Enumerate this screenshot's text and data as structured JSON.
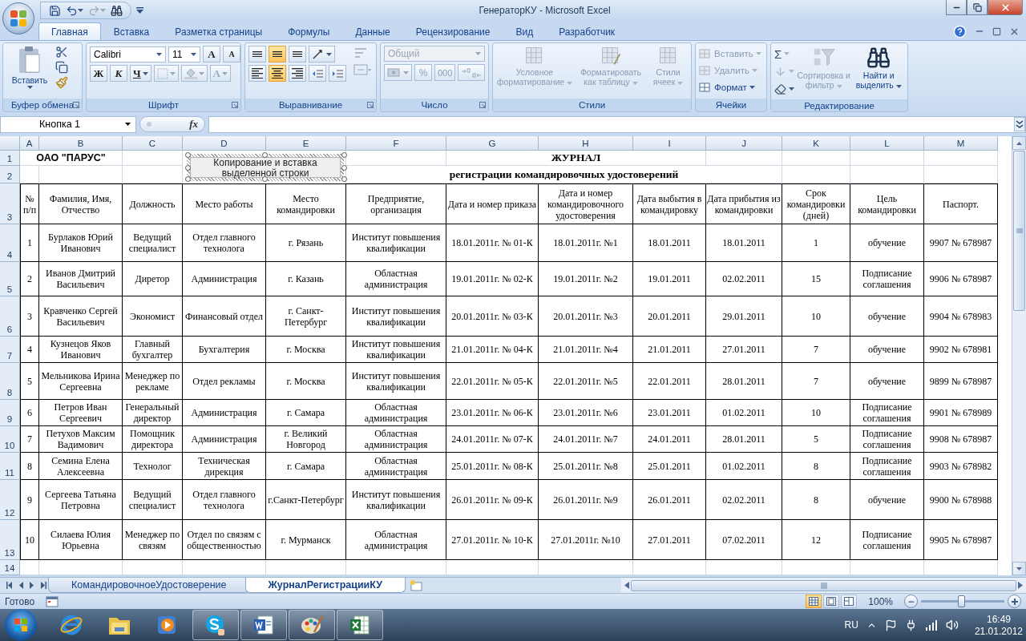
{
  "window": {
    "title": "ГенераторКУ - Microsoft Excel"
  },
  "ribbon_tabs": [
    {
      "label": "Главная",
      "selected": true
    },
    {
      "label": "Вставка",
      "selected": false
    },
    {
      "label": "Разметка страницы",
      "selected": false
    },
    {
      "label": "Формулы",
      "selected": false
    },
    {
      "label": "Данные",
      "selected": false
    },
    {
      "label": "Рецензирование",
      "selected": false
    },
    {
      "label": "Вид",
      "selected": false
    },
    {
      "label": "Разработчик",
      "selected": false
    }
  ],
  "ribbon": {
    "clipboard": {
      "label": "Буфер обмена",
      "paste": "Вставить"
    },
    "font": {
      "label": "Шрифт",
      "name": "Calibri",
      "size": "11",
      "grow": "A",
      "shrink": "A",
      "bold": "Ж",
      "italic": "К",
      "underline": "Ч",
      "color_letter": "A"
    },
    "alignment": {
      "label": "Выравнивание",
      "vertical": [
        {
          "selected": false
        },
        {
          "selected": true
        },
        {
          "selected": false
        }
      ],
      "horizontal": [
        {
          "selected": false
        },
        {
          "selected": true
        },
        {
          "selected": false
        }
      ]
    },
    "number": {
      "label": "Число",
      "format": "Общий",
      "format_disabled": true,
      "percent": "%",
      "thousands": "000"
    },
    "styles": {
      "label": "Стили",
      "items": [
        {
          "label": "Условное форматирование",
          "disabled": true
        },
        {
          "label": "Форматировать как таблицу",
          "disabled": true
        },
        {
          "label": "Стили ячеек",
          "disabled": true
        }
      ]
    },
    "cells": {
      "label": "Ячейки",
      "items": [
        {
          "label": "Вставить",
          "disabled": true
        },
        {
          "label": "Удалить",
          "disabled": true
        },
        {
          "label": "Формат",
          "disabled": false
        }
      ]
    },
    "editing": {
      "label": "Редактирование",
      "sum": "Σ",
      "items": [
        {
          "label": "Сортировка и фильтр",
          "disabled": true
        },
        {
          "label": "Найти и выделить",
          "disabled": false
        }
      ]
    }
  },
  "formula_bar": {
    "name_box": "Кнопка 1",
    "fx": "fx"
  },
  "sheet": {
    "columns": [
      "A",
      "B",
      "C",
      "D",
      "E",
      "F",
      "G",
      "H",
      "I",
      "J",
      "K",
      "L",
      "M"
    ],
    "rows": [
      "1",
      "2",
      "3",
      "4",
      "5",
      "6",
      "7",
      "8",
      "9",
      "10",
      "11",
      "12",
      "13",
      "14"
    ],
    "company": "ОАО \"ПАРУС\"",
    "title": "ЖУРНАЛ",
    "subtitle": "регистрации командировочных удостоверений",
    "button": "Копирование и вставка выделенной строки",
    "header": [
      "№ п/п",
      "Фамилия, Имя, Отчество",
      "Должность",
      "Место работы",
      "Место командировки",
      "Предприятие, организация",
      "Дата и номер приказа",
      "Дата и номер командировочного удостоверения",
      "Дата выбытия в командировку",
      "Дата прибытия из командировки",
      "Срок командировки (дней)",
      "Цель командировки",
      "Паспорт."
    ],
    "records": [
      [
        "1",
        "Бурлаков Юрий Иванович",
        "Ведущий специалист",
        "Отдел главного технолога",
        "г. Рязань",
        "Институт повышения квалификации",
        "18.01.2011г. № 01-К",
        "18.01.2011г. №1",
        "18.01.2011",
        "18.01.2011",
        "1",
        "обучение",
        "9907 № 678987"
      ],
      [
        "2",
        "Иванов Дмитрий Васильевич",
        "Диретор",
        "Администрация",
        "г. Казань",
        "Областная администрация",
        "19.01.2011г. № 02-К",
        "19.01.2011г. №2",
        "19.01.2011",
        "02.02.2011",
        "15",
        "Подписание соглашения",
        "9906 № 678987"
      ],
      [
        "3",
        "Кравченко Сергей Васильевич",
        "Экономист",
        "Финансовый отдел",
        "г. Санкт-Петербург",
        "Институт повышения квалификации",
        "20.01.2011г. № 03-К",
        "20.01.2011г. №3",
        "20.01.2011",
        "29.01.2011",
        "10",
        "обучение",
        "9904 № 678983"
      ],
      [
        "4",
        "Кузнецов Яков Иванович",
        "Главный бухгалтер",
        "Бухгалтерия",
        "г. Москва",
        "Институт повышения квалификации",
        "21.01.2011г. № 04-К",
        "21.01.2011г. №4",
        "21.01.2011",
        "27.01.2011",
        "7",
        "обучение",
        "9902 № 678981"
      ],
      [
        "5",
        "Мельникова Ирина Сергеевна",
        "Менеджер по рекламе",
        "Отдел рекламы",
        "г. Москва",
        "Институт повышения квалификации",
        "22.01.2011г. № 05-К",
        "22.01.2011г. №5",
        "22.01.2011",
        "28.01.2011",
        "7",
        "обучение",
        "9899 № 678987"
      ],
      [
        "6",
        "Петров Иван Сергеевич",
        "Генеральный директор",
        "Администрация",
        "г. Самара",
        "Областная администрация",
        "23.01.2011г. № 06-К",
        "23.01.2011г. №6",
        "23.01.2011",
        "01.02.2011",
        "10",
        "Подписание соглашения",
        "9901 № 678989"
      ],
      [
        "7",
        "Петухов Максим Вадимович",
        "Помощник директора",
        "Администрация",
        "г. Великий Новгород",
        "Областная администрация",
        "24.01.2011г. № 07-К",
        "24.01.2011г. №7",
        "24.01.2011",
        "28.01.2011",
        "5",
        "Подписание соглашения",
        "9908 № 678987"
      ],
      [
        "8",
        "Семина Елена Алексеевна",
        "Технолог",
        "Техническая дирекция",
        "г. Самара",
        "Областная администрация",
        "25.01.2011г. № 08-К",
        "25.01.2011г. №8",
        "25.01.2011",
        "01.02.2011",
        "8",
        "Подписание соглашения",
        "9903 № 678982"
      ],
      [
        "9",
        "Сергеева Татьяна Петровна",
        "Ведущий специалист",
        "Отдел главного технолога",
        "г.Санкт-Петербург",
        "Институт повышения квалификации",
        "26.01.2011г. № 09-К",
        "26.01.2011г. №9",
        "26.01.2011",
        "02.02.2011",
        "8",
        "обучение",
        "9900 № 678988"
      ],
      [
        "10",
        "Силаева Юлия Юрьевна",
        "Менеджер по связям",
        "Отдел по связям с общественностью",
        "г. Мурманск",
        "Областная администрация",
        "27.01.2011г. № 10-К",
        "27.01.2011г. №10",
        "27.01.2011",
        "07.02.2011",
        "12",
        "Подписание соглашения",
        "9905 № 678987"
      ]
    ]
  },
  "sheet_tabs": [
    {
      "label": "КомандировочноеУдостоверение",
      "selected": false
    },
    {
      "label": "ЖурналРегистрацииКУ",
      "selected": true
    }
  ],
  "status_bar": {
    "text": "Готово",
    "zoom": "100%",
    "views": [
      {
        "selected": true
      },
      {
        "selected": false
      },
      {
        "selected": false
      }
    ],
    "zoom_slider": {
      "level": 0.48
    }
  },
  "taskbar": {
    "apps": [
      {
        "kind": "ie",
        "running": false
      },
      {
        "kind": "explorer",
        "running": false
      },
      {
        "kind": "media",
        "running": false
      },
      {
        "kind": "skype",
        "running": true
      },
      {
        "kind": "word",
        "running": true
      },
      {
        "kind": "paint",
        "running": true
      },
      {
        "kind": "excel",
        "running": true
      }
    ],
    "language": "RU",
    "time": "16:49",
    "date": "21.01.2012"
  }
}
